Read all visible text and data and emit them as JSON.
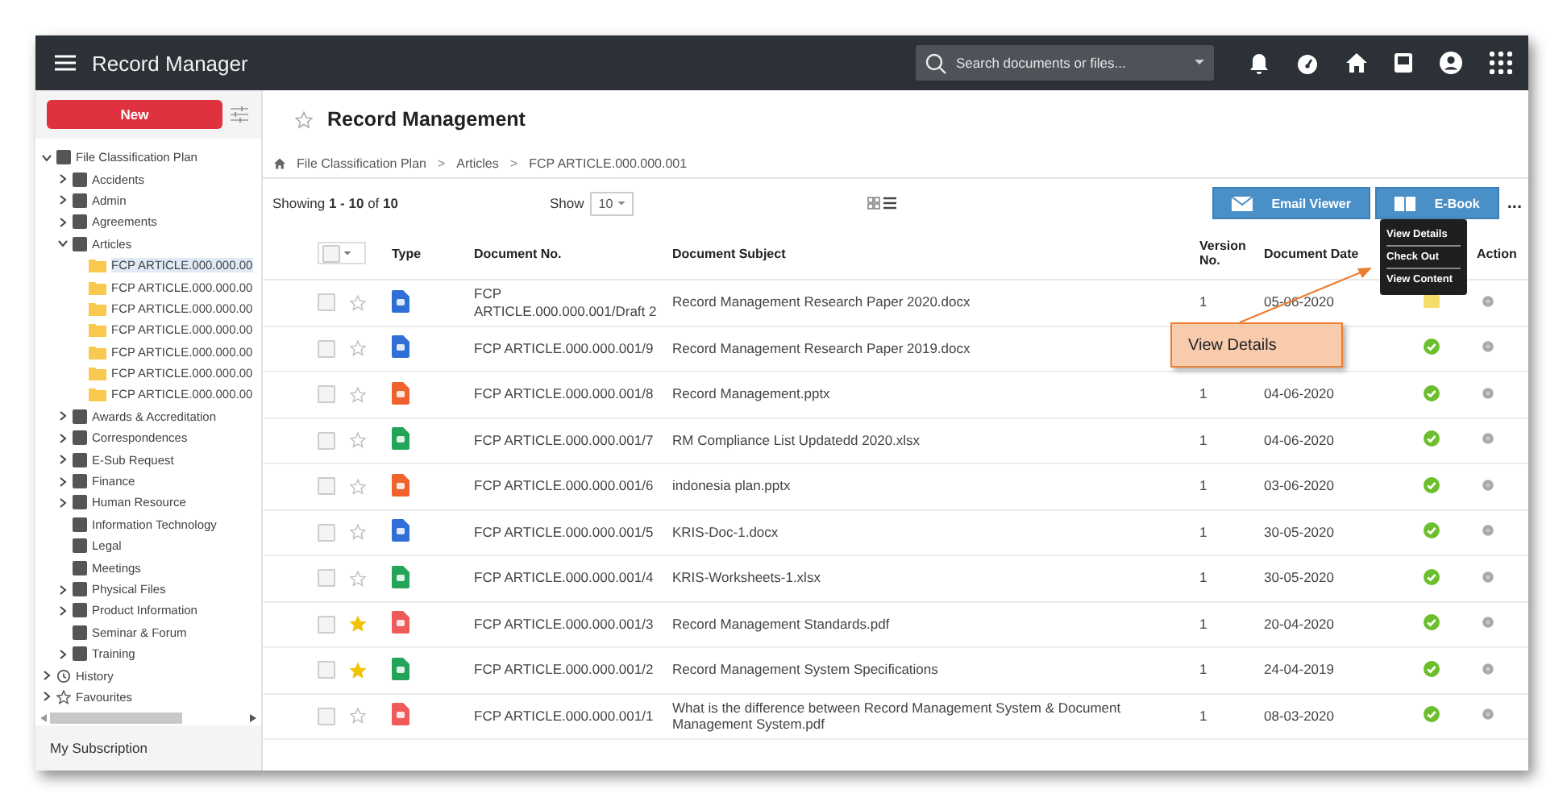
{
  "app_bar": {
    "title": "Record Manager",
    "search": {
      "placeholder": "Search documents or files..."
    }
  },
  "sidebar": {
    "new_button": "New",
    "tree": [
      {
        "label": "File Classification Plan",
        "kind": "cabinet",
        "expanded": true,
        "selected": false,
        "children": [
          {
            "label": "Accidents",
            "kind": "cabinet",
            "expanded": false,
            "selected": false
          },
          {
            "label": "Admin",
            "kind": "cabinet",
            "expanded": false,
            "selected": false
          },
          {
            "label": "Agreements",
            "kind": "cabinet",
            "expanded": false,
            "selected": false
          },
          {
            "label": "Articles",
            "kind": "cabinet",
            "expanded": true,
            "selected": false,
            "children": [
              {
                "label": "FCP ARTICLE.000.000.00",
                "kind": "folder",
                "selected": true
              },
              {
                "label": "FCP ARTICLE.000.000.00",
                "kind": "folder",
                "selected": false
              },
              {
                "label": "FCP ARTICLE.000.000.00",
                "kind": "folder",
                "selected": false
              },
              {
                "label": "FCP ARTICLE.000.000.00",
                "kind": "folder",
                "selected": false
              },
              {
                "label": "FCP ARTICLE.000.000.00",
                "kind": "folder",
                "selected": false
              },
              {
                "label": "FCP ARTICLE.000.000.00",
                "kind": "folder",
                "selected": false
              },
              {
                "label": "FCP ARTICLE.000.000.00",
                "kind": "folder",
                "selected": false
              }
            ]
          },
          {
            "label": "Awards & Accreditation",
            "kind": "cabinet",
            "expanded": false,
            "selected": false
          },
          {
            "label": "Correspondences",
            "kind": "cabinet",
            "expanded": false,
            "selected": false
          },
          {
            "label": "E-Sub Request",
            "kind": "cabinet",
            "expanded": false,
            "selected": false
          },
          {
            "label": "Finance",
            "kind": "cabinet",
            "expanded": false,
            "selected": false
          },
          {
            "label": "Human Resource",
            "kind": "cabinet",
            "expanded": false,
            "selected": false
          },
          {
            "label": "Information Technology",
            "kind": "cabinet",
            "selected": false
          },
          {
            "label": "Legal",
            "kind": "cabinet",
            "selected": false
          },
          {
            "label": "Meetings",
            "kind": "cabinet",
            "selected": false
          },
          {
            "label": "Physical Files",
            "kind": "cabinet",
            "expanded": false,
            "selected": false
          },
          {
            "label": "Product Information",
            "kind": "cabinet",
            "expanded": false,
            "selected": false
          },
          {
            "label": "Seminar & Forum",
            "kind": "cabinet",
            "selected": false
          },
          {
            "label": "Training",
            "kind": "cabinet",
            "expanded": false,
            "selected": false
          }
        ]
      },
      {
        "label": "History",
        "kind": "history",
        "expanded": false,
        "selected": false
      },
      {
        "label": "Favourites",
        "kind": "star",
        "expanded": false,
        "selected": false
      }
    ],
    "footer": "My Subscription"
  },
  "page": {
    "title": "Record Management",
    "favorite": false,
    "breadcrumb": [
      {
        "kind": "link",
        "text": "File Classification Plan"
      },
      {
        "kind": "separator",
        "text": ">"
      },
      {
        "kind": "link",
        "text": "Articles"
      },
      {
        "kind": "separator",
        "text": ">"
      },
      {
        "kind": "link",
        "text": "FCP ARTICLE.000.000.001"
      }
    ],
    "select_all": {
      "checked": false
    },
    "showing": "Showing **1 - 10** of **10**",
    "show_label": "Show",
    "page_size": "10",
    "buttons": [
      "Email Viewer",
      "E-Book"
    ],
    "more": "...",
    "columns": [
      "Type",
      "Document No.",
      "Document Subject",
      "Version No.",
      "Document Date",
      "Action"
    ],
    "rows": [
      {
        "checked": false,
        "starred": false,
        "kind": "word",
        "doc_no": "FCP ARTICLE.000.000.001/Draft 2",
        "subject": "Record Management Research Paper 2020.docx",
        "version": "1",
        "date": "05-06-2020",
        "approved": false
      },
      {
        "checked": false,
        "starred": false,
        "kind": "word",
        "doc_no": "FCP ARTICLE.000.000.001/9",
        "subject": "Record Management Research Paper 2019.docx",
        "approved": true
      },
      {
        "checked": false,
        "starred": false,
        "kind": "ppt",
        "doc_no": "FCP ARTICLE.000.000.001/8",
        "subject": "Record Management.pptx",
        "version": "1",
        "date": "04-06-2020",
        "approved": true
      },
      {
        "checked": false,
        "starred": false,
        "kind": "excel",
        "doc_no": "FCP ARTICLE.000.000.001/7",
        "subject": "RM Compliance List Updatedd 2020.xlsx",
        "version": "1",
        "date": "04-06-2020",
        "approved": true
      },
      {
        "checked": false,
        "starred": false,
        "kind": "ppt",
        "doc_no": "FCP ARTICLE.000.000.001/6",
        "subject": "indonesia plan.pptx",
        "version": "1",
        "date": "03-06-2020",
        "approved": true
      },
      {
        "checked": false,
        "starred": false,
        "kind": "word",
        "doc_no": "FCP ARTICLE.000.000.001/5",
        "subject": "KRIS-Doc-1.docx",
        "version": "1",
        "date": "30-05-2020",
        "approved": true
      },
      {
        "checked": false,
        "starred": false,
        "kind": "excel",
        "doc_no": "FCP ARTICLE.000.000.001/4",
        "subject": "KRIS-Worksheets-1.xlsx",
        "version": "1",
        "date": "30-05-2020",
        "approved": true
      },
      {
        "checked": false,
        "starred": true,
        "kind": "pdf",
        "doc_no": "FCP ARTICLE.000.000.001/3",
        "subject": "Record Management Standards.pdf",
        "version": "1",
        "date": "20-04-2020",
        "approved": true
      },
      {
        "checked": false,
        "starred": true,
        "kind": "excel",
        "doc_no": "FCP ARTICLE.000.000.001/2",
        "subject": "Record Management System Specifications",
        "version": "1",
        "date": "24-04-2019",
        "approved": true
      },
      {
        "checked": false,
        "starred": false,
        "kind": "pdf",
        "doc_no": "FCP ARTICLE.000.000.001/1",
        "subject": "What is the difference between Record Management System & Document Management System.pdf",
        "version": "1",
        "date": "08-03-2020",
        "approved": true
      }
    ],
    "menu": [
      "View Details",
      "Check Out",
      "View Content"
    ],
    "callout": "View Details"
  }
}
